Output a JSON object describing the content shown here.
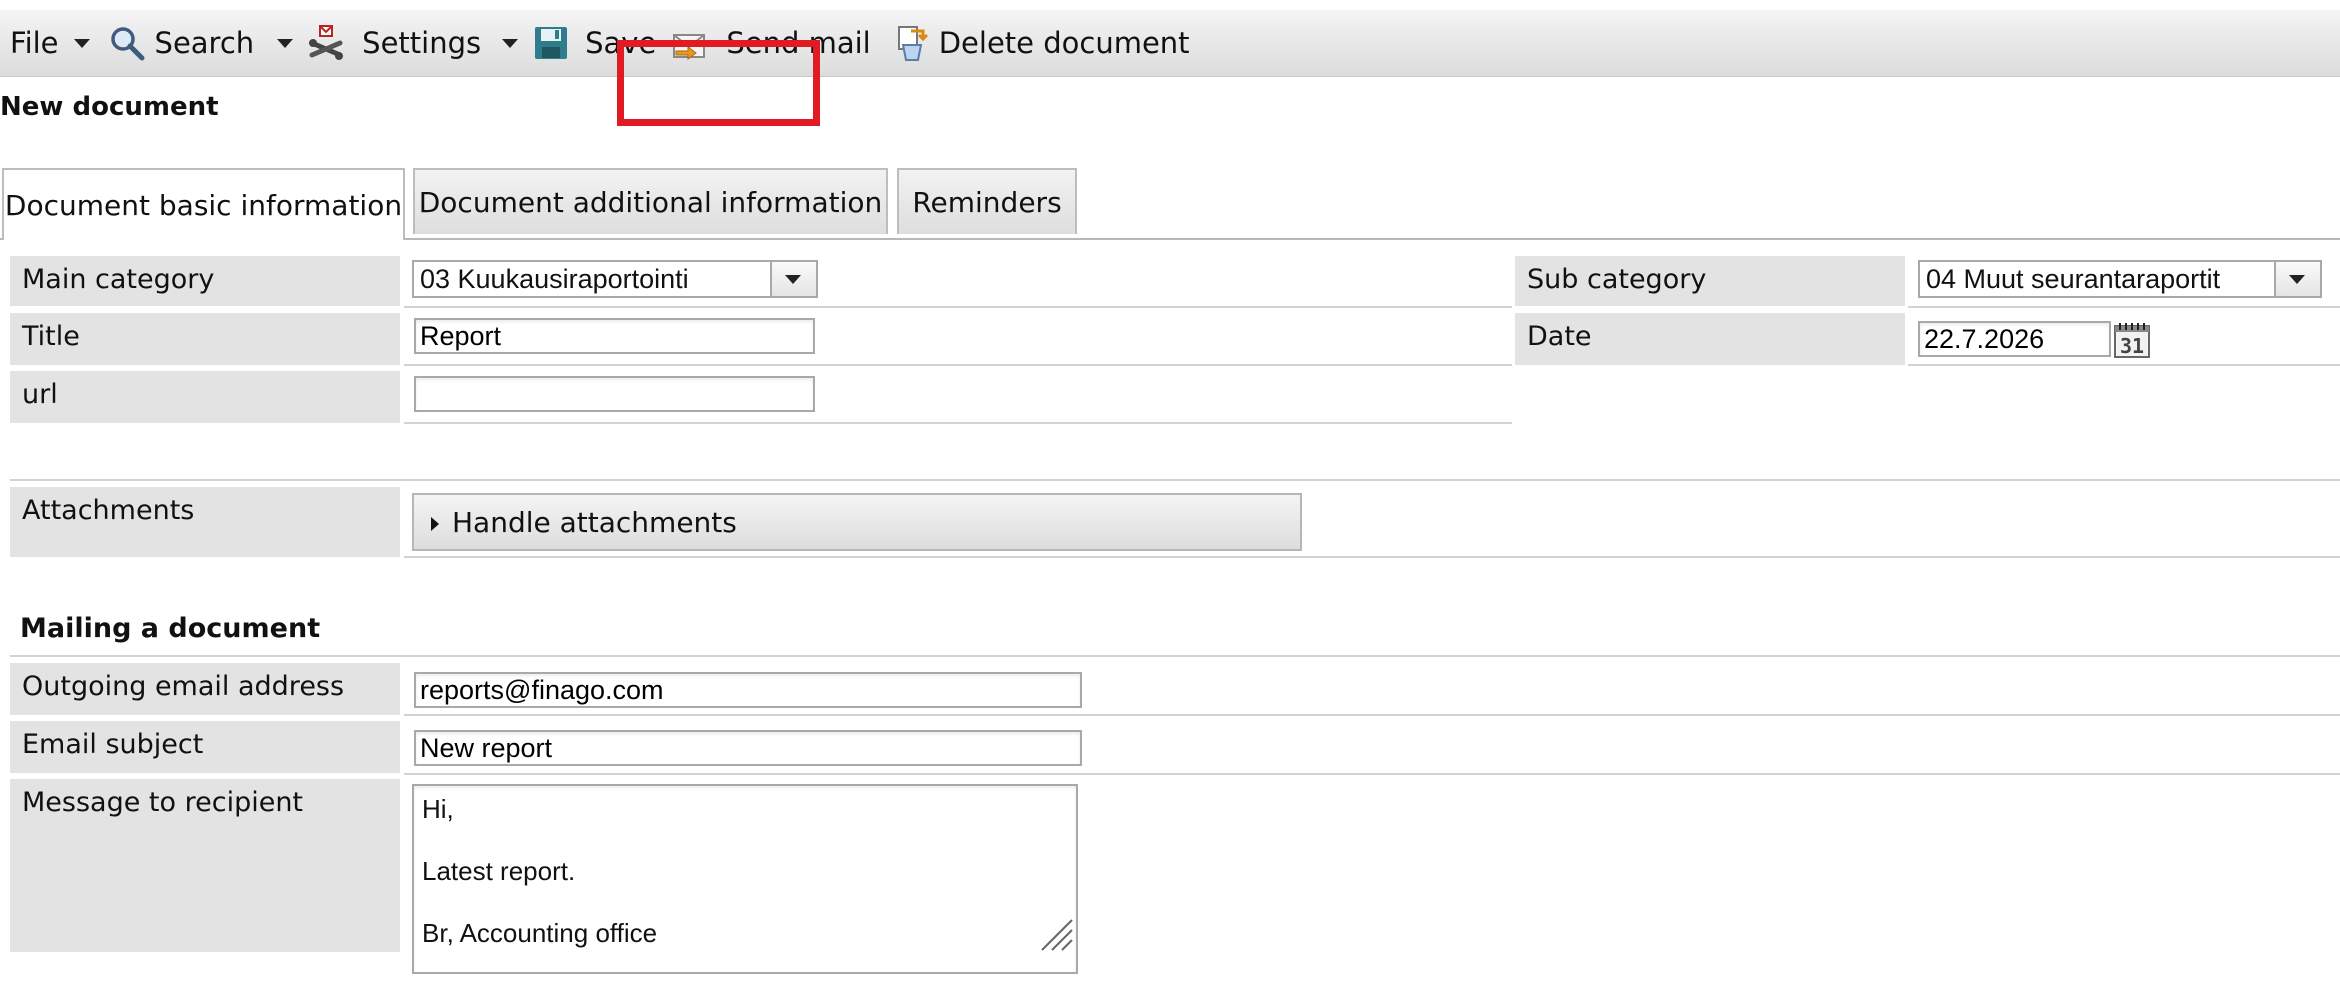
{
  "toolbar": {
    "file_label": "File",
    "search_label": "Search",
    "settings_label": "Settings",
    "save_label": "Save",
    "send_mail_label": "Send mail",
    "delete_label": "Delete document",
    "highlight_color": "#e01b24"
  },
  "page_title": "New document",
  "tabs": [
    {
      "label": "Document basic information",
      "active": true
    },
    {
      "label": "Document additional information",
      "active": false
    },
    {
      "label": "Reminders",
      "active": false
    }
  ],
  "form": {
    "main_category": {
      "label": "Main category",
      "value": "03 Kuukausiraportointi"
    },
    "sub_category": {
      "label": "Sub category",
      "value": "04 Muut seurantaraportit"
    },
    "title": {
      "label": "Title",
      "value": "Report"
    },
    "date": {
      "label": "Date",
      "value": "22.7.2026",
      "calendar_day": "31"
    },
    "url": {
      "label": "url",
      "value": ""
    },
    "attachments": {
      "label": "Attachments",
      "button_label": "Handle attachments"
    }
  },
  "mailing": {
    "section_title": "Mailing a document",
    "outgoing_email": {
      "label": "Outgoing email address",
      "value": "reports@finago.com"
    },
    "email_subject": {
      "label": "Email subject",
      "value": "New report"
    },
    "message": {
      "label": "Message to recipient",
      "lines": [
        "Hi,",
        "Latest report.",
        "Br, Accounting office"
      ]
    }
  }
}
